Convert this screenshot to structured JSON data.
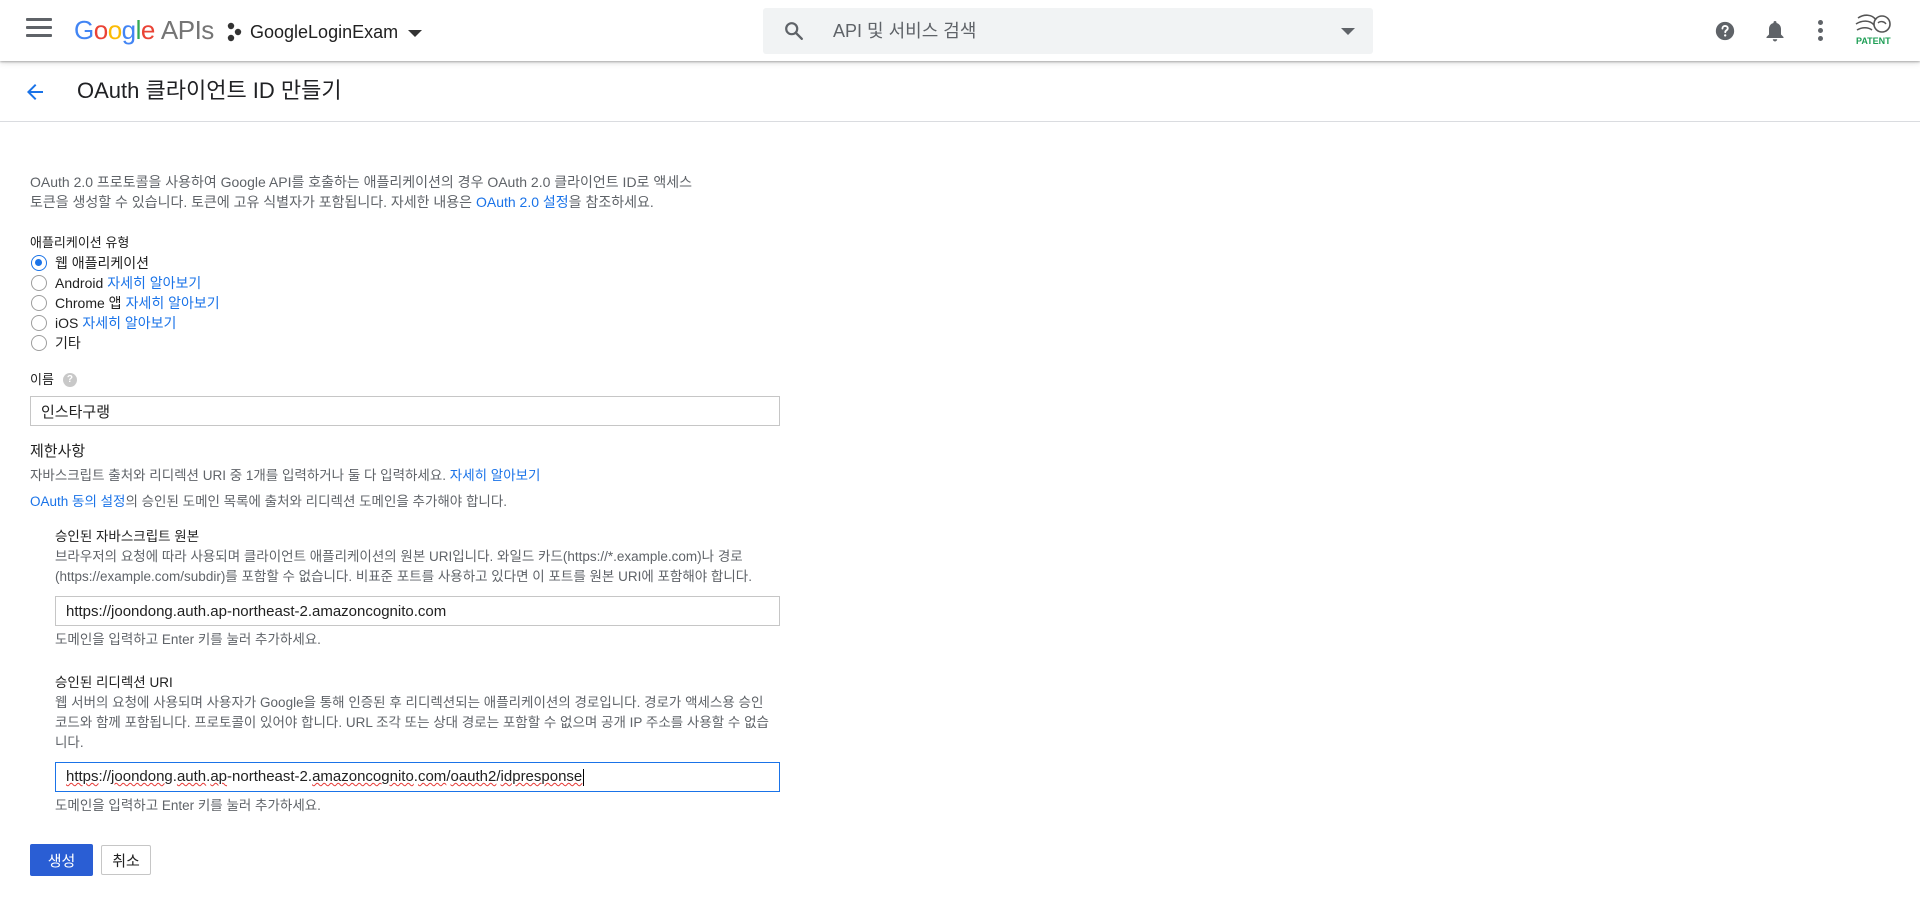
{
  "header": {
    "logo": {
      "g1": "G",
      "g2": "o",
      "g3": "o",
      "g4": "g",
      "g5": "l",
      "g6": "e",
      "apis": "APIs"
    },
    "project_name": "GoogleLoginExam",
    "search_placeholder": "API 및 서비스 검색",
    "avatar_text": "PATENT"
  },
  "page": {
    "title": "OAuth 클라이언트 ID 만들기"
  },
  "intro": {
    "line1": "OAuth 2.0 프로토콜을 사용하여 Google API를 호출하는 애플리케이션의 경우 OAuth 2.0 클라이언트 ID로 액세스",
    "line2_before": "토큰을 생성할 수 있습니다. 토큰에 고유 식별자가 포함됩니다. 자세한 내용은 ",
    "link": "OAuth 2.0 설정",
    "line2_after": "을 참조하세요."
  },
  "app_type": {
    "label": "애플리케이션 유형",
    "options": [
      {
        "label": "웹 애플리케이션",
        "link": "",
        "checked": true
      },
      {
        "label": "Android",
        "link": "자세히 알아보기",
        "checked": false
      },
      {
        "label": "Chrome 앱",
        "link": "자세히 알아보기",
        "checked": false
      },
      {
        "label": "iOS",
        "link": "자세히 알아보기",
        "checked": false
      },
      {
        "label": "기타",
        "link": "",
        "checked": false
      }
    ]
  },
  "name_field": {
    "label": "이름",
    "help": "?",
    "value": "인스타구랭"
  },
  "restrictions": {
    "title": "제한사항",
    "desc": "자바스크립트 출처와 리디렉션 URI 중 1개를 입력하거나 둘 다 입력하세요. ",
    "desc_link": "자세히 알아보기",
    "consent_link": "OAuth 동의 설정",
    "consent_after": "의 승인된 도메인 목록에 출처와 리디렉션 도메인을 추가해야 합니다."
  },
  "js_origins": {
    "title": "승인된 자바스크립트 원본",
    "desc": "브라우저의 요청에 따라 사용되며 클라이언트 애플리케이션의 원본 URI입니다. 와일드 카드(https://*.example.com)나 경로(https://example.com/subdir)를 포함할 수 없습니다. 비표준 포트를 사용하고 있다면 이 포트를 원본 URI에 포함해야 합니다.",
    "value": "https://joondong.auth.ap-northeast-2.amazoncognito.com",
    "hint": "도메인을 입력하고 Enter 키를 눌러 추가하세요."
  },
  "redirect_uris": {
    "title": "승인된 리디렉션 URI",
    "desc": "웹 서버의 요청에 사용되며 사용자가 Google을 통해 인증된 후 리디렉션되는 애플리케이션의 경로입니다. 경로가 액세스용 승인 코드와 함께 포함됩니다. 프로토콜이 있어야 합니다. URL 조각 또는 상대 경로는 포함할 수 없으며 공개 IP 주소를 사용할 수 없습니다.",
    "value_parts": [
      "https",
      "://",
      "joondong",
      ".",
      "auth",
      ".",
      "ap",
      "-northeast-2.",
      "amazoncognito",
      ".",
      "com",
      "/",
      "oauth2",
      "/",
      "idpresponse"
    ],
    "hint": "도메인을 입력하고 Enter 키를 눌러 추가하세요."
  },
  "buttons": {
    "create": "생성",
    "cancel": "취소"
  },
  "colors": {
    "accent": "#1a73e8",
    "primary_button": "#2a5ed4"
  }
}
